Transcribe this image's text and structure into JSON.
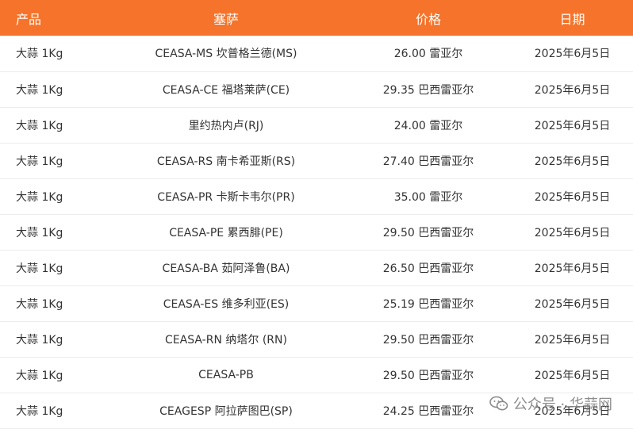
{
  "header": {
    "product": "产品",
    "province": "塞萨",
    "price": "价格",
    "date": "日期"
  },
  "rows": [
    {
      "product": "大蒜 1Kg",
      "ceasa": "CEASA-MS 坎普格兰德(MS)",
      "price": "26.00 雷亚尔",
      "date": "2025年6月5日"
    },
    {
      "product": "大蒜 1Kg",
      "ceasa": "CEASA-CE 福塔莱萨(CE)",
      "price": "29.35 巴西雷亚尔",
      "date": "2025年6月5日"
    },
    {
      "product": "大蒜 1Kg",
      "ceasa": "里约热内卢(RJ)",
      "price": "24.00 雷亚尔",
      "date": "2025年6月5日"
    },
    {
      "product": "大蒜 1Kg",
      "ceasa": "CEASA-RS 南卡希亚斯(RS)",
      "price": "27.40 巴西雷亚尔",
      "date": "2025年6月5日"
    },
    {
      "product": "大蒜 1Kg",
      "ceasa": "CEASA-PR 卡斯卡韦尔(PR)",
      "price": "35.00 雷亚尔",
      "date": "2025年6月5日"
    },
    {
      "product": "大蒜 1Kg",
      "ceasa": "CEASA-PE 累西腓(PE)",
      "price": "29.50 巴西雷亚尔",
      "date": "2025年6月5日"
    },
    {
      "product": "大蒜 1Kg",
      "ceasa": "CEASA-BA 茹阿泽鲁(BA)",
      "price": "26.50 巴西雷亚尔",
      "date": "2025年6月5日"
    },
    {
      "product": "大蒜 1Kg",
      "ceasa": "CEASA-ES 维多利亚(ES)",
      "price": "25.19 巴西雷亚尔",
      "date": "2025年6月5日"
    },
    {
      "product": "大蒜 1Kg",
      "ceasa": "CEASA-RN 纳塔尔 (RN)",
      "price": "29.50 巴西雷亚尔",
      "date": "2025年6月5日"
    },
    {
      "product": "大蒜 1Kg",
      "ceasa": "CEASA-PB",
      "price": "29.50 巴西雷亚尔",
      "date": "2025年6月5日"
    },
    {
      "product": "大蒜 1Kg",
      "ceasa": "CEAGESP 阿拉萨图巴(SP)",
      "price": "24.25 巴西雷亚尔",
      "date": "2025年6月5日"
    }
  ],
  "watermark": {
    "text": "公众号 · 华蒜网",
    "icon": "wechat-icon"
  },
  "colors": {
    "header_bg": "#f5732a",
    "header_text": "#ffffff",
    "row_divider": "#ececec"
  }
}
